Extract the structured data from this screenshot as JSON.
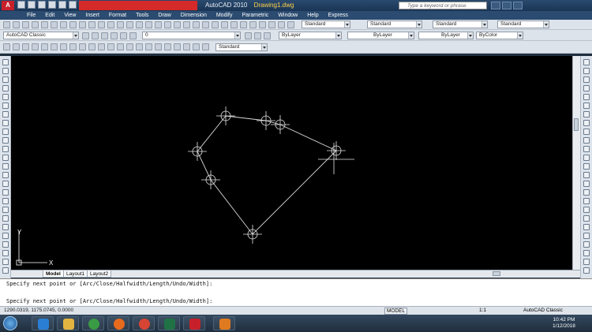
{
  "window": {
    "app_title": "AutoCAD 2010",
    "doc_title": "Drawing1.dwg",
    "search_placeholder": "Type a keyword or phrase"
  },
  "menu": [
    "File",
    "Edit",
    "View",
    "Insert",
    "Format",
    "Tools",
    "Draw",
    "Dimension",
    "Modify",
    "Parametric",
    "Window",
    "Help",
    "Express"
  ],
  "toolbar1": {
    "text_style": "Standard",
    "dim_style": "Standard",
    "table_style": "Standard",
    "mleader_style": "Standard"
  },
  "toolbar2": {
    "workspace": "AutoCAD Classic",
    "layer_value": "0",
    "color_control": "ByLayer",
    "linetype_control": "ByLayer",
    "lineweight_control": "ByLayer",
    "plotstyle_control": "ByColor"
  },
  "toolbar3": {
    "style_combo": "Standard"
  },
  "canvas": {
    "ucs_x": "X",
    "ucs_y": "Y"
  },
  "tabs": [
    "Model",
    "Layout1",
    "Layout2"
  ],
  "command": {
    "line1": "Specify next point or [Arc/Close/Halfwidth/Length/Undo/Width]:",
    "line2": "Specify next point or [Arc/Close/Halfwidth/Length/Undo/Width]:"
  },
  "status": {
    "coords": "1290.0319, 1175.0745, 0.0000",
    "model_button": "MODEL",
    "annotation_scale": "1:1",
    "workspace": "AutoCAD Classic"
  },
  "taskbar": {
    "time": "10:42 PM",
    "date": "1/12/2018"
  },
  "colors": {
    "canvas_bg": "#000000",
    "polyline": "#d9d9d9",
    "title_bar": "#1a3555",
    "menu_bar": "#2b4b70"
  }
}
